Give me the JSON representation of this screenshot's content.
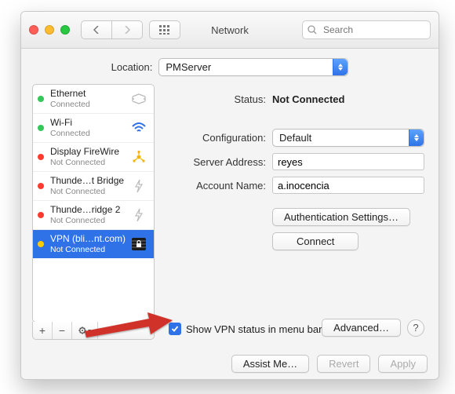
{
  "window": {
    "title": "Network"
  },
  "toolbar": {
    "search_placeholder": "Search"
  },
  "location": {
    "label": "Location:",
    "value": "PMServer"
  },
  "sidebar": {
    "items": [
      {
        "name": "Ethernet",
        "status": "Connected",
        "dot": "g",
        "icon": "ethernet"
      },
      {
        "name": "Wi-Fi",
        "status": "Connected",
        "dot": "g",
        "icon": "wifi"
      },
      {
        "name": "Display FireWire",
        "status": "Not Connected",
        "dot": "r",
        "icon": "firewire"
      },
      {
        "name": "Thunde…t Bridge",
        "status": "Not Connected",
        "dot": "r",
        "icon": "thunderbolt"
      },
      {
        "name": "Thunde…ridge 2",
        "status": "Not Connected",
        "dot": "r",
        "icon": "thunderbolt"
      },
      {
        "name": "VPN (bli…nt.com)",
        "status": "Not Connected",
        "dot": "y",
        "icon": "vpn",
        "selected": true
      }
    ],
    "buttons": {
      "add": "+",
      "remove": "−",
      "action": "⚙︎▾"
    }
  },
  "detail": {
    "status_label": "Status:",
    "status_value": "Not Connected",
    "config_label": "Configuration:",
    "config_value": "Default",
    "server_label": "Server Address:",
    "server_value": "reyes",
    "account_label": "Account Name:",
    "account_value": "a.inocencia",
    "auth_button": "Authentication Settings…",
    "connect_button": "Connect",
    "show_status_label": "Show VPN status in menu bar",
    "show_status_checked": true,
    "advanced_button": "Advanced…",
    "help_button": "?"
  },
  "footer": {
    "assist": "Assist Me…",
    "revert": "Revert",
    "apply": "Apply"
  }
}
